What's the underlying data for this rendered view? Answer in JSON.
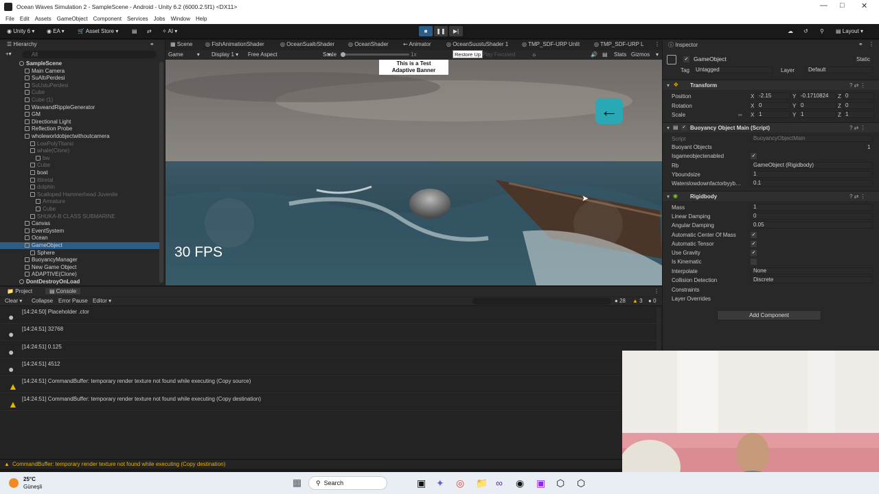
{
  "window": {
    "title": "Ocean Waves Simulation 2 - SampleScene - Android - Unity 6.2 (6000.2.5f1) <DX11>"
  },
  "menu": [
    "File",
    "Edit",
    "Assets",
    "GameObject",
    "Component",
    "Services",
    "Jobs",
    "Window",
    "Help"
  ],
  "toolbar": {
    "unity_label": "Unity 6",
    "ea": "EA",
    "asset_store": "Asset Store",
    "ai": "AI",
    "layout": "Layout"
  },
  "tabs": {
    "hierarchy": "Hierarchy",
    "scene": "Scene",
    "fish": "FishAnimationShader",
    "oceansualti": "OceanSualtıShader",
    "oceanshader": "OceanShader",
    "animator": "Animator",
    "oceansuustu": "OceanSuustuShader 1",
    "tmp1": "TMP_SDF-URP Unlit",
    "tmp2": "TMP_SDF-URP L",
    "inspector": "Inspector",
    "project": "Project",
    "console": "Console"
  },
  "hierarchy": {
    "search": "All",
    "items": [
      {
        "label": "SampleScene",
        "indent": 0,
        "dim": false,
        "scene": true
      },
      {
        "label": "Main Camera",
        "indent": 1,
        "dim": false
      },
      {
        "label": "SuAltıPerdesi",
        "indent": 1,
        "dim": false
      },
      {
        "label": "SuUstuPerdesi",
        "indent": 1,
        "dim": true
      },
      {
        "label": "Cube",
        "indent": 1,
        "dim": true
      },
      {
        "label": "Cube (1)",
        "indent": 1,
        "dim": true
      },
      {
        "label": "WaveandRippleGenerator",
        "indent": 1,
        "dim": false
      },
      {
        "label": "GM",
        "indent": 1,
        "dim": false
      },
      {
        "label": "Directional Light",
        "indent": 1,
        "dim": false
      },
      {
        "label": "Reflection Probe",
        "indent": 1,
        "dim": false
      },
      {
        "label": "wholeworldobjectwithoutcamera",
        "indent": 1,
        "dim": false
      },
      {
        "label": "LowPolyTitanic",
        "indent": 2,
        "dim": true
      },
      {
        "label": "whale(Clone)",
        "indent": 2,
        "dim": true
      },
      {
        "label": "bw",
        "indent": 3,
        "dim": true
      },
      {
        "label": "Cube",
        "indent": 2,
        "dim": true
      },
      {
        "label": "boat",
        "indent": 2,
        "dim": false
      },
      {
        "label": "ittiretal",
        "indent": 2,
        "dim": true
      },
      {
        "label": "dolphin",
        "indent": 2,
        "dim": true
      },
      {
        "label": "Scalloped Hammerhead Juvenile",
        "indent": 2,
        "dim": true
      },
      {
        "label": "Armature",
        "indent": 3,
        "dim": true
      },
      {
        "label": "Cube",
        "indent": 3,
        "dim": true
      },
      {
        "label": "SHUKA-B CLASS SUBMARINE",
        "indent": 2,
        "dim": true
      },
      {
        "label": "Canvas",
        "indent": 1,
        "dim": false
      },
      {
        "label": "EventSystem",
        "indent": 1,
        "dim": false
      },
      {
        "label": "Ocean",
        "indent": 1,
        "dim": false
      },
      {
        "label": "GameObject",
        "indent": 1,
        "dim": false,
        "selected": true
      },
      {
        "label": "Sphere",
        "indent": 2,
        "dim": false
      },
      {
        "label": "BuoyancyManager",
        "indent": 1,
        "dim": false
      },
      {
        "label": "New Game Object",
        "indent": 1,
        "dim": false
      },
      {
        "label": "ADAPTIVE(Clone)",
        "indent": 1,
        "dim": false
      },
      {
        "label": "DontDestroyOnLoad",
        "indent": 0,
        "dim": false,
        "scene": true
      }
    ]
  },
  "game": {
    "mode": "Game",
    "display": "Display 1",
    "aspect": "Free Aspect",
    "scale_label": "Scale",
    "scale_value": "1x",
    "tooltip": "Restore Up",
    "play_focused": "Play Focused",
    "stats": "Stats",
    "gizmos": "Gizmos",
    "banner_line1": "This is a Test",
    "banner_line2": "Adaptive Banner",
    "fps": "30 FPS"
  },
  "console": {
    "clear": "Clear",
    "collapse": "Collapse",
    "error_pause": "Error Pause",
    "editor": "Editor",
    "count_info": "28",
    "count_warn": "3",
    "count_err": "0",
    "logs": [
      {
        "type": "info",
        "text": "[14:24:50] Placeholder .ctor"
      },
      {
        "type": "info",
        "text": "[14:24:51] 32768"
      },
      {
        "type": "info",
        "text": "[14:24:51] 0.125"
      },
      {
        "type": "info",
        "text": "[14:24:51] 4512"
      },
      {
        "type": "warn",
        "text": "[14:24:51] CommandBuffer: temporary render texture  not found while executing  (Copy source)"
      },
      {
        "type": "warn",
        "text": "[14:24:51] CommandBuffer: temporary render texture  not found while executing  (Copy destination)"
      }
    ],
    "status": "CommandBuffer: temporary render texture  not found while executing  (Copy destination)"
  },
  "inspector": {
    "name": "GameObject",
    "static": "Static",
    "tag_label": "Tag",
    "tag": "Untagged",
    "layer_label": "Layer",
    "layer": "Default",
    "transform": {
      "title": "Transform",
      "position": "Position",
      "rotation": "Rotation",
      "scale": "Scale",
      "px": "-2.15",
      "py": "-0.1710824",
      "pz": "0",
      "rx": "0",
      "ry": "0",
      "rz": "0",
      "sx": "1",
      "sy": "1",
      "sz": "1"
    },
    "buoyancy": {
      "title": "Buoyancy Object Main (Script)",
      "script_label": "Script",
      "script": "BuoyancyObjectMain",
      "buoyant_objects": "Buoyant Objects",
      "buoyant_count": "1",
      "isgame": "Isgameobjectenabled",
      "rb": "Rb",
      "rb_value": "GameObject (Rigidbody)",
      "ybound": "Yboundsize",
      "ybound_value": "1",
      "water": "Waterslowdownfactorbyyb…",
      "water_value": "0.1"
    },
    "rigidbody": {
      "title": "Rigidbody",
      "mass": "Mass",
      "mass_value": "1",
      "lin": "Linear Damping",
      "lin_value": "0",
      "ang": "Angular Damping",
      "ang_value": "0.05",
      "acm": "Automatic Center Of Mass",
      "at": "Automatic Tensor",
      "grav": "Use Gravity",
      "kin": "Is Kinematic",
      "interp": "Interpolate",
      "interp_value": "None",
      "coll": "Collision Detection",
      "coll_value": "Discrete",
      "constraints": "Constraints",
      "layer_ov": "Layer Overrides"
    },
    "add_component": "Add Component"
  },
  "taskbar": {
    "temp": "25°C",
    "weather": "Güneşli",
    "search": "Search"
  },
  "colors": {
    "accent": "#2c5d87",
    "bg": "#191919",
    "panel": "#282828",
    "warn": "#e8b400"
  }
}
